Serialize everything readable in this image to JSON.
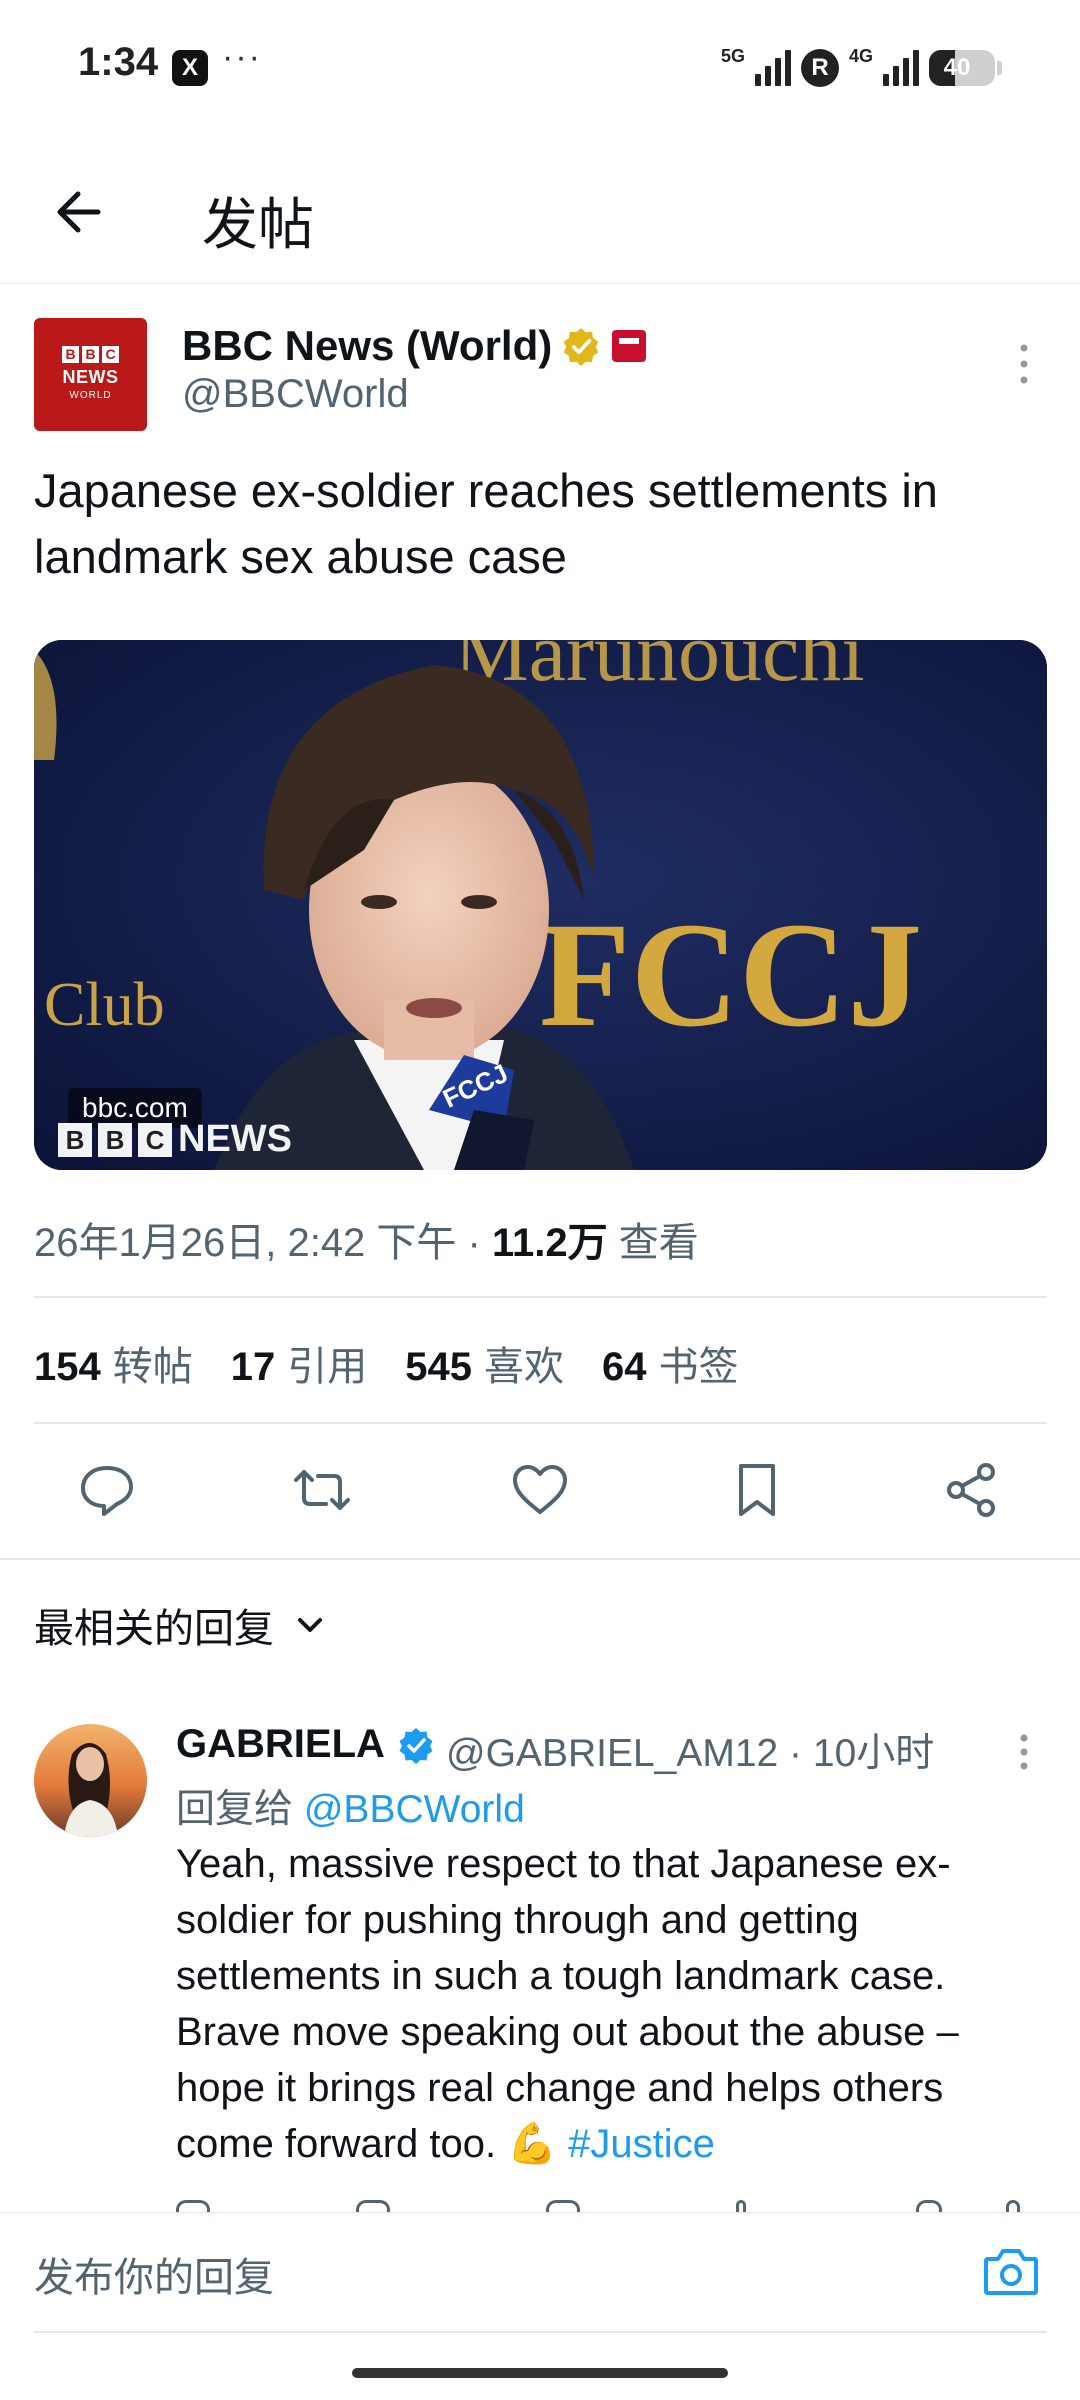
{
  "status_bar": {
    "time": "1:34",
    "app_icon": "X",
    "overflow": "···",
    "network_1": "5G",
    "network_2": "4G",
    "vpn_badge": "R",
    "battery_level": "40"
  },
  "header": {
    "title": "发帖"
  },
  "post": {
    "author": {
      "name": "BBC News (World)",
      "handle": "@BBCWorld",
      "avatar_text_1": "B",
      "avatar_text_2": "B",
      "avatar_text_3": "C",
      "avatar_text_4": "NEWS",
      "avatar_text_5": "WORLD"
    },
    "text": "Japanese ex-soldier reaches settlements in landmark sex abuse case",
    "media": {
      "domain": "bbc.com",
      "watermark_blocks": [
        "B",
        "B",
        "C"
      ],
      "watermark_text": "NEWS",
      "backdrop_text_1": "Marunouchi",
      "backdrop_text_2": "FCCJ",
      "backdrop_text_3": "Club"
    },
    "timestamp": "26年1月26日, 2:42 下午 · ",
    "views_count": "11.2万",
    "views_label": " 查看",
    "stats": [
      {
        "count": "154",
        "label": "转帖"
      },
      {
        "count": "17",
        "label": "引用"
      },
      {
        "count": "545",
        "label": "喜欢"
      },
      {
        "count": "64",
        "label": "书签"
      }
    ]
  },
  "sort": {
    "label": "最相关的回复"
  },
  "reply": {
    "name": "GABRIELA",
    "handle_time": "@GABRIEL_AM12 · 10小时",
    "reply_to_prefix": "回复给 ",
    "reply_to_handle": "@BBCWorld",
    "text": "Yeah, massive respect to that Japanese ex-soldier for pushing through and getting settlements in such a tough landmark case. Brave move speaking out about the abuse – hope it brings real change and helps others come forward too. 💪 ",
    "hashtag": "#Justice"
  },
  "compose": {
    "placeholder": "发布你的回复"
  },
  "colors": {
    "accent": "#1d9bf0",
    "verified_gold": "#e2b719",
    "bbc_red": "#bb1919",
    "secondary_text": "#536471"
  }
}
